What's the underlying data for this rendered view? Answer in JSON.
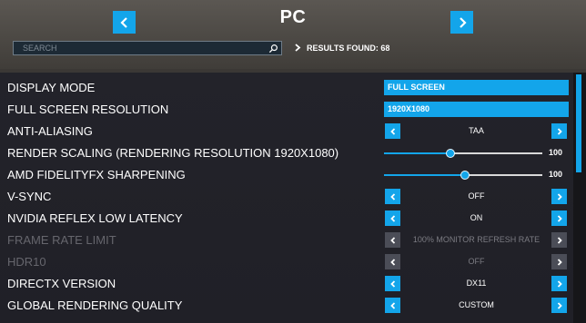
{
  "header": {
    "title": "PC",
    "search_placeholder": "SEARCH",
    "results_found": "RESULTS FOUND: 68",
    "accent": "#13a5ea"
  },
  "settings": [
    {
      "label": "DISPLAY MODE",
      "type": "select",
      "value": "FULL SCREEN",
      "disabled": false
    },
    {
      "label": "FULL SCREEN RESOLUTION",
      "type": "select",
      "value": "1920X1080",
      "disabled": false
    },
    {
      "label": "ANTI-ALIASING",
      "type": "stepper",
      "value": "TAA",
      "disabled": false
    },
    {
      "label": "RENDER SCALING (RENDERING RESOLUTION 1920X1080)",
      "type": "slider",
      "value": "100",
      "fraction": 0.42,
      "disabled": false
    },
    {
      "label": "AMD FIDELITYFX SHARPENING",
      "type": "slider",
      "value": "100",
      "fraction": 0.51,
      "disabled": false
    },
    {
      "label": "V-SYNC",
      "type": "stepper",
      "value": "OFF",
      "disabled": false
    },
    {
      "label": "NVIDIA REFLEX LOW LATENCY",
      "type": "stepper",
      "value": "ON",
      "disabled": false
    },
    {
      "label": "FRAME RATE LIMIT",
      "type": "stepper",
      "value": "100% MONITOR REFRESH RATE",
      "disabled": true
    },
    {
      "label": "HDR10",
      "type": "stepper",
      "value": "OFF",
      "disabled": true
    },
    {
      "label": "DIRECTX VERSION",
      "type": "stepper",
      "value": "DX11",
      "disabled": false
    },
    {
      "label": "GLOBAL RENDERING QUALITY",
      "type": "stepper",
      "value": "CUSTOM",
      "disabled": false
    }
  ]
}
